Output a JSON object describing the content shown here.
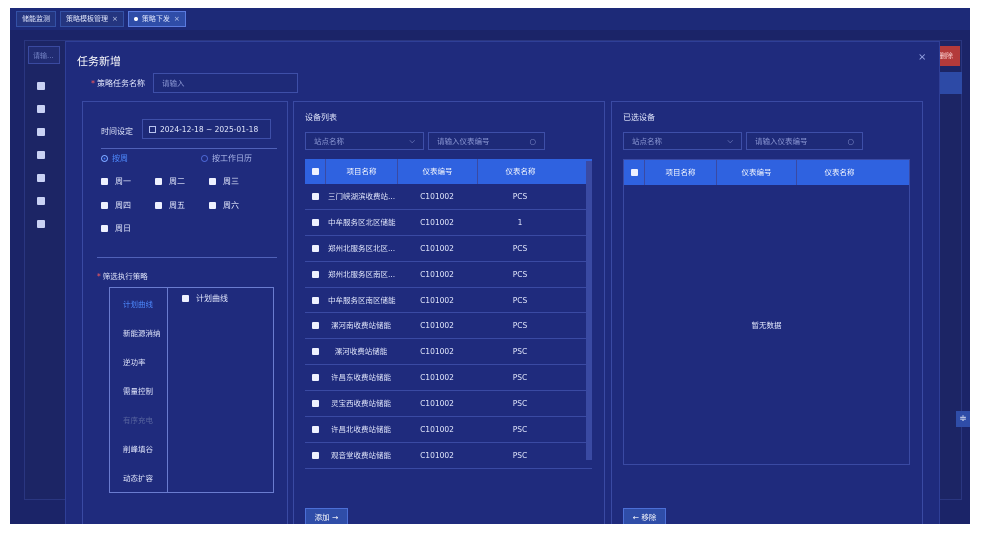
{
  "tabs": [
    {
      "label": "储能监测",
      "active": false,
      "closable": false
    },
    {
      "label": "策略模板管理",
      "active": false,
      "closable": true
    },
    {
      "label": "策略下发",
      "active": true,
      "closable": true
    }
  ],
  "background": {
    "search_placeholder": "请输...",
    "delete_label": "删除"
  },
  "modal": {
    "title": "任务新增",
    "close": "×",
    "task_name_label": "策略任务名称",
    "task_name_placeholder": "请输入",
    "time_label": "时间设定",
    "date_range": "2024-12-18 ~ 2025-01-18",
    "mode_week": "按周",
    "mode_calendar": "按工作日历",
    "weekdays": [
      "周一",
      "周二",
      "周三",
      "周四",
      "周五",
      "周六",
      "周日"
    ],
    "strategy_label": "筛选执行策略",
    "strategies": [
      {
        "label": "计划曲线",
        "state": "active"
      },
      {
        "label": "新能源消纳",
        "state": "normal"
      },
      {
        "label": "逆功率",
        "state": "normal"
      },
      {
        "label": "需量控制",
        "state": "normal"
      },
      {
        "label": "有序充电",
        "state": "disabled"
      },
      {
        "label": "削峰填谷",
        "state": "normal"
      },
      {
        "label": "动态扩容",
        "state": "normal"
      }
    ],
    "strategy_option": "计划曲线"
  },
  "device_list": {
    "title": "设备列表",
    "station_placeholder": "站点名称",
    "meter_placeholder": "请输入仪表编号",
    "columns": [
      "项目名称",
      "仪表编号",
      "仪表名称"
    ],
    "rows": [
      [
        "三门峡湖滨收费站...",
        "C101002",
        "PCS"
      ],
      [
        "中牟服务区北区储能",
        "C101002",
        "1"
      ],
      [
        "郑州北服务区北区...",
        "C101002",
        "PCS"
      ],
      [
        "郑州北服务区南区...",
        "C101002",
        "PCS"
      ],
      [
        "中牟服务区南区储能",
        "C101002",
        "PCS"
      ],
      [
        "漯河南收费站储能",
        "C101002",
        "PCS"
      ],
      [
        "漯河收费站储能",
        "C101002",
        "PSC"
      ],
      [
        "许昌东收费站储能",
        "C101002",
        "PSC"
      ],
      [
        "灵宝西收费站储能",
        "C101002",
        "PSC"
      ],
      [
        "许昌北收费站储能",
        "C101002",
        "PSC"
      ],
      [
        "观音堂收费站储能",
        "C101002",
        "PSC"
      ]
    ],
    "add_button": "添加 →"
  },
  "selected_devices": {
    "title": "已选设备",
    "station_placeholder": "站点名称",
    "meter_placeholder": "请输入仪表编号",
    "columns": [
      "项目名称",
      "仪表编号",
      "仪表名称"
    ],
    "empty_text": "暂无数据",
    "remove_button": "← 移除"
  }
}
